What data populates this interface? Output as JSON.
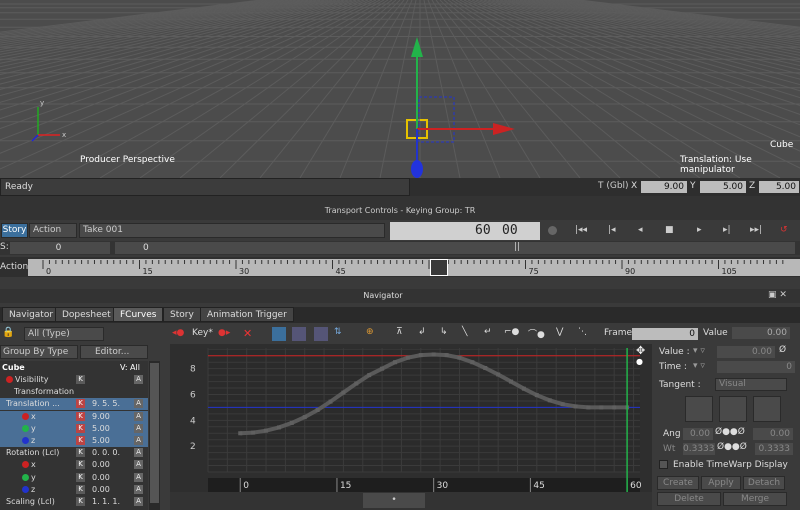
{
  "viewport": {
    "camera_label": "Producer Perspective",
    "object_label": "Cube",
    "manip_label": "Translation: Use manipulator"
  },
  "status": {
    "text": "Ready",
    "coord_label": "T (Gbl)",
    "x_label": "X",
    "x_value": "9.00",
    "y_label": "Y",
    "y_value": "5.00",
    "z_label": "Z",
    "z_value": "5.00"
  },
  "transport": {
    "title": "Transport Controls  -  Keying Group: TR",
    "story_label": "Story",
    "action_label": "Action",
    "take_label": "Take 001",
    "frame_big": "60",
    "frame_big2": "00",
    "s_label": "S:",
    "s_value": "0",
    "s_value2": "0",
    "pipe_text": "||",
    "ruler_label": "Action",
    "ruler_ticks": [
      "0",
      "15",
      "30",
      "45",
      "60",
      "75",
      "90",
      "105"
    ]
  },
  "navigator": {
    "title": "Navigator",
    "tabs": [
      "Navigator",
      "Dopesheet",
      "FCurves",
      "Story",
      "Animation Trigger"
    ],
    "filter_label": "All (Type)",
    "group_by": "Group By Type",
    "editor_label": "Editor...",
    "tree_header": "Cube",
    "tree_header_v": "V: All",
    "rows": [
      {
        "label": "Visibility",
        "value": ""
      },
      {
        "label": "Transformation",
        "value": ""
      },
      {
        "label": "Translation ...",
        "value": "9.  5.  5."
      },
      {
        "label": "x",
        "value": "9.00"
      },
      {
        "label": "y",
        "value": "5.00"
      },
      {
        "label": "z",
        "value": "5.00"
      },
      {
        "label": "Rotation (Lcl)",
        "value": "0.  0.  0."
      },
      {
        "label": "x",
        "value": "0.00"
      },
      {
        "label": "y",
        "value": "0.00"
      },
      {
        "label": "z",
        "value": "0.00"
      },
      {
        "label": "Scaling (Lcl)",
        "value": "1.  1.  1."
      }
    ]
  },
  "fcurve": {
    "key_label": "Key*",
    "frame_label": "Frame",
    "frame_value": "0",
    "value_label": "Value",
    "value_value": "0.00",
    "y_ticks": [
      "8",
      "6",
      "4",
      "2"
    ],
    "x_ticks": [
      "0",
      "15",
      "30",
      "45",
      "60"
    ]
  },
  "props": {
    "value_label": "Value :",
    "value_field": "0.00",
    "time_label": "Time :",
    "time_field": "0",
    "tangent_label": "Tangent :",
    "tangent_value": "Visual",
    "ang_label": "Ang",
    "ang_left": "0.00",
    "ang_right": "0.00",
    "wt_label": "Wt",
    "wt_left": "0.3333",
    "wt_right": "0.3333",
    "timewarp_label": "Enable TimeWarp Display",
    "create_label": "Create",
    "apply_label": "Apply",
    "detach_label": "Detach",
    "delete_label": "Delete",
    "merge_label": "Merge"
  },
  "chart_data": {
    "type": "line",
    "x_range": [
      -5,
      62
    ],
    "y_range": [
      0,
      9.6
    ],
    "series": [
      {
        "name": "",
        "color": "#cc2222",
        "x": [
          -5,
          62
        ],
        "y": [
          9.0,
          9.0
        ]
      },
      {
        "name": "",
        "color": "#2233cc",
        "x": [
          -5,
          62
        ],
        "y": [
          5.0,
          5.0
        ]
      },
      {
        "name": "",
        "color": "#5a5a5a",
        "x": [
          0,
          2,
          4,
          6,
          8,
          10,
          12,
          14,
          16,
          18,
          20,
          22,
          24,
          26,
          28,
          30,
          32,
          34,
          36,
          38,
          40,
          42,
          44,
          46,
          48,
          50,
          52,
          54,
          56,
          58,
          60
        ],
        "y": [
          3.0,
          3.05,
          3.2,
          3.45,
          3.8,
          4.25,
          4.8,
          5.45,
          6.15,
          6.85,
          7.5,
          8.0,
          8.5,
          8.85,
          9.05,
          9.1,
          9.05,
          8.85,
          8.5,
          8.05,
          7.55,
          7.0,
          6.45,
          5.95,
          5.55,
          5.25,
          5.08,
          5.0,
          5.0,
          5.0,
          5.0
        ]
      }
    ],
    "current_frame": 60
  },
  "colors": {
    "grid": "#5c5c5c",
    "accent_blue": "#3b6f9c",
    "red": "#cc2222",
    "green": "#22b34a"
  }
}
